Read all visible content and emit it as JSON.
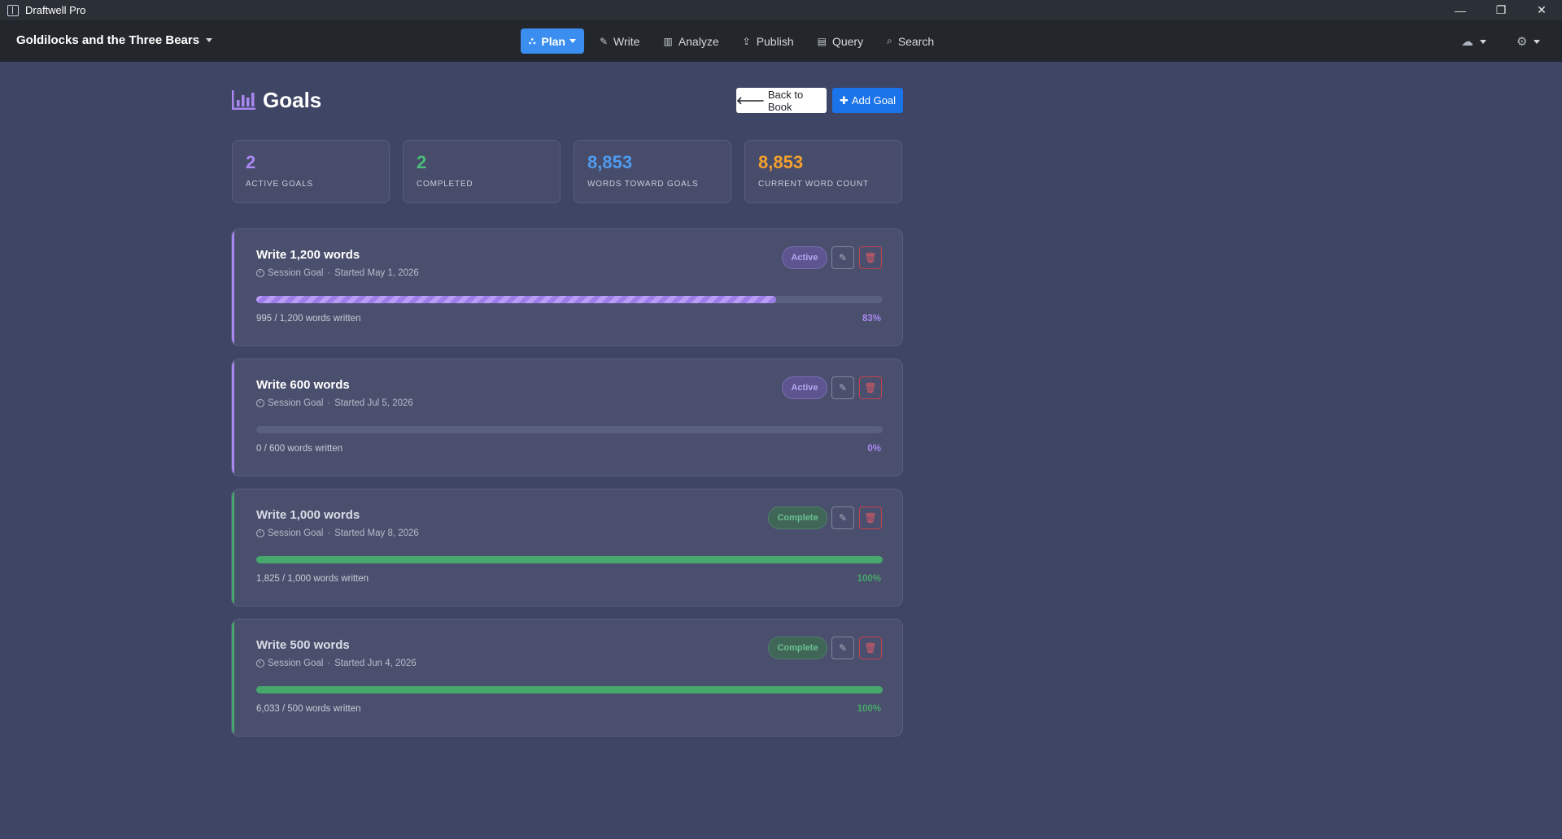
{
  "window": {
    "title": "Draftwell Pro",
    "minimize": "—",
    "restore": "❐",
    "close": "✕"
  },
  "navbar": {
    "book_title": "Goldilocks and the Three Bears",
    "items": [
      {
        "label": "Plan",
        "icon": "sitemap-icon",
        "glyph": "⛬",
        "active": true
      },
      {
        "label": "Write",
        "icon": "pencil-icon",
        "glyph": "✎"
      },
      {
        "label": "Analyze",
        "icon": "bar-chart-icon",
        "glyph": "▥"
      },
      {
        "label": "Publish",
        "icon": "upload-icon",
        "glyph": "⇪"
      },
      {
        "label": "Query",
        "icon": "list-icon",
        "glyph": "▤"
      },
      {
        "label": "Search",
        "icon": "search-icon",
        "glyph": "⌕"
      }
    ],
    "cloud_glyph": "☁",
    "settings_glyph": "⚙"
  },
  "page": {
    "title": "Goals",
    "back_glyph": "🡐",
    "back_label": "Back to Book",
    "add_glyph": "✚",
    "add_label": "Add Goal"
  },
  "stats": [
    {
      "value": "2",
      "label": "ACTIVE GOALS",
      "color": "#a987f0"
    },
    {
      "value": "2",
      "label": "COMPLETED",
      "color": "#4cbb7c"
    },
    {
      "value": "8,853",
      "label": "WORDS TOWARD GOALS",
      "color": "#4f9bf0"
    },
    {
      "value": "8,853",
      "label": "CURRENT WORD COUNT",
      "color": "#f4a02c"
    }
  ],
  "goals": [
    {
      "title": "Write 1,200 words",
      "type": "Session Goal",
      "dot": "·",
      "started": "Started May 1, 2026",
      "status": "Active",
      "progress_text": "995 / 1,200 words written",
      "percent_text": "83%",
      "progress": 0.83
    },
    {
      "title": "Write 600 words",
      "type": "Session Goal",
      "dot": "·",
      "started": "Started Jul 5, 2026",
      "status": "Active",
      "progress_text": "0 / 600 words written",
      "percent_text": "0%",
      "progress": 0
    },
    {
      "title": "Write 1,000 words",
      "type": "Session Goal",
      "dot": "·",
      "started": "Started May 8, 2026",
      "status": "Complete",
      "progress_text": "1,825 / 1,000 words written",
      "percent_text": "100%",
      "progress": 1
    },
    {
      "title": "Write 500 words",
      "type": "Session Goal",
      "dot": "·",
      "started": "Started Jun 4, 2026",
      "status": "Complete",
      "progress_text": "6,033 / 500 words written",
      "percent_text": "100%",
      "progress": 1
    }
  ],
  "goal_actions": {
    "edit_glyph": "✎",
    "delete_glyph": "🗑"
  },
  "colors": {
    "active_accent": "#a987f0",
    "complete_accent": "#46a86c",
    "primary": "#1a73e8"
  }
}
